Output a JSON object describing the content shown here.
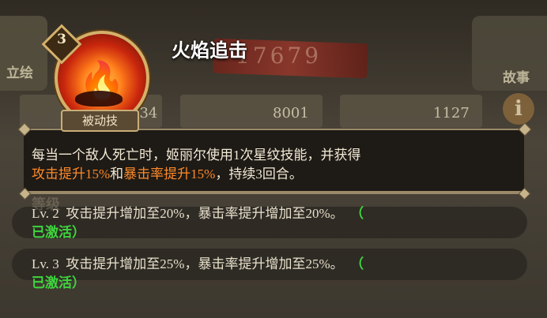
{
  "background": {
    "left_tab_label": "立绘",
    "right_tab_label": "故事",
    "info_button": "i",
    "power_value": "17679",
    "stats": [
      {
        "icon": "heart-icon",
        "value": "734"
      },
      {
        "icon": "sword-icon",
        "value": "8001"
      },
      {
        "icon": "shield-icon",
        "value": "1127"
      }
    ],
    "ghost_text": "等级"
  },
  "skill": {
    "name": "火焰追击",
    "level_badge": "3",
    "type_tag": "被动技",
    "icon": "flame-hand-icon"
  },
  "description": {
    "line1": "每当一个敌人死亡时，姬丽尔使用1次星纹技能，并获得",
    "hl1": "攻击提升15%",
    "mid": "和",
    "hl2": "暴击率提升15%",
    "tail": "，持续3回合。"
  },
  "levels": [
    {
      "label": "Lv. 2",
      "text": "攻击提升增加至20%，暴击率提升增加至20%。",
      "status_open": "（",
      "status": "已激活）"
    },
    {
      "label": "Lv. 3",
      "text": "攻击提升增加至25%，暴击率提升增加至25%。",
      "status_open": "（",
      "status": "已激活）"
    }
  ],
  "colors": {
    "highlight": "#ff8a2a",
    "active": "#3fd53f",
    "frame_gold": "#d4b06a"
  }
}
